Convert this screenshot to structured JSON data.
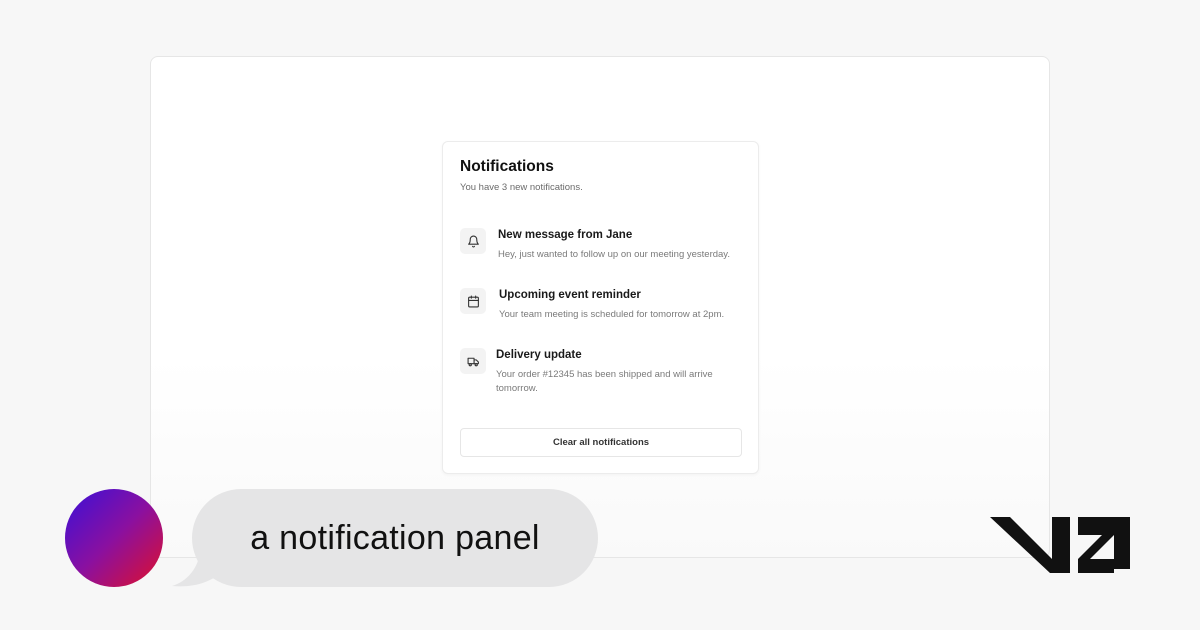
{
  "panel": {
    "title": "Notifications",
    "subtitle": "You have 3 new notifications.",
    "items": [
      {
        "icon": "bell-icon",
        "title": "New message from Jane",
        "description": "Hey, just wanted to follow up on our meeting yesterday."
      },
      {
        "icon": "calendar-icon",
        "title": "Upcoming event reminder",
        "description": "Your team meeting is scheduled for tomorrow at 2pm."
      },
      {
        "icon": "truck-icon",
        "title": "Delivery update",
        "description": "Your order #12345 has been shipped and will arrive tomorrow."
      }
    ],
    "clear_label": "Clear all notifications"
  },
  "prompt": {
    "text": "a notification panel"
  },
  "brand": {
    "logo": "v0-logo",
    "avatar_gradient": [
      "#3a10d8",
      "#e0102a"
    ]
  }
}
